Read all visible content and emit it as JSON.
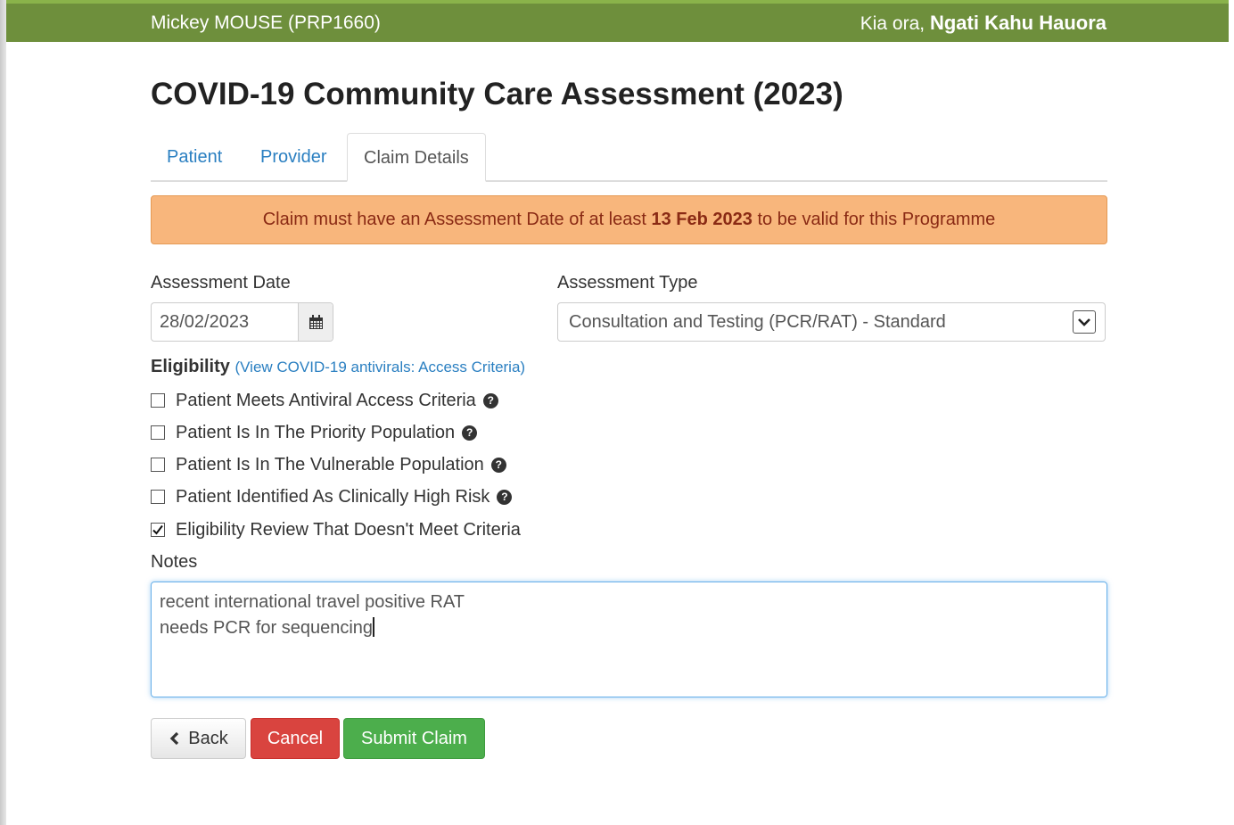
{
  "header": {
    "patient": "Mickey MOUSE (PRP1660)",
    "greeting": "Kia ora,",
    "organisation": "Ngati Kahu Hauora"
  },
  "page": {
    "title": "COVID-19 Community Care Assessment (2023)"
  },
  "tabs": [
    {
      "label": "Patient",
      "active": false
    },
    {
      "label": "Provider",
      "active": false
    },
    {
      "label": "Claim Details",
      "active": true
    }
  ],
  "alert": {
    "prefix": "Claim must have an Assessment Date of at least ",
    "date": "13 Feb 2023",
    "suffix": " to be valid for this Programme"
  },
  "form": {
    "assessment_date_label": "Assessment Date",
    "assessment_date_value": "28/02/2023",
    "assessment_type_label": "Assessment Type",
    "assessment_type_value": "Consultation and Testing (PCR/RAT) - Standard",
    "eligibility_title": "Eligibility",
    "eligibility_link": "(View COVID-19 antivirals: Access Criteria)",
    "checks": [
      {
        "label": "Patient Meets Antiviral Access Criteria",
        "checked": false,
        "help": true
      },
      {
        "label": "Patient Is In The Priority Population",
        "checked": false,
        "help": true
      },
      {
        "label": "Patient Is In The Vulnerable Population",
        "checked": false,
        "help": true
      },
      {
        "label": "Patient Identified As Clinically High Risk",
        "checked": false,
        "help": true
      },
      {
        "label": "Eligibility Review That Doesn't Meet Criteria",
        "checked": true,
        "help": false
      }
    ],
    "notes_label": "Notes",
    "notes_line1": "recent international travel positive RAT",
    "notes_line2": "needs PCR for sequencing"
  },
  "buttons": {
    "back": "Back",
    "cancel": "Cancel",
    "submit": "Submit Claim"
  },
  "colors": {
    "header_bg": "#6e8f3c",
    "alert_bg": "#f8b67c",
    "link": "#2a7fc1",
    "cancel": "#d9443f",
    "submit": "#4cae4c"
  }
}
